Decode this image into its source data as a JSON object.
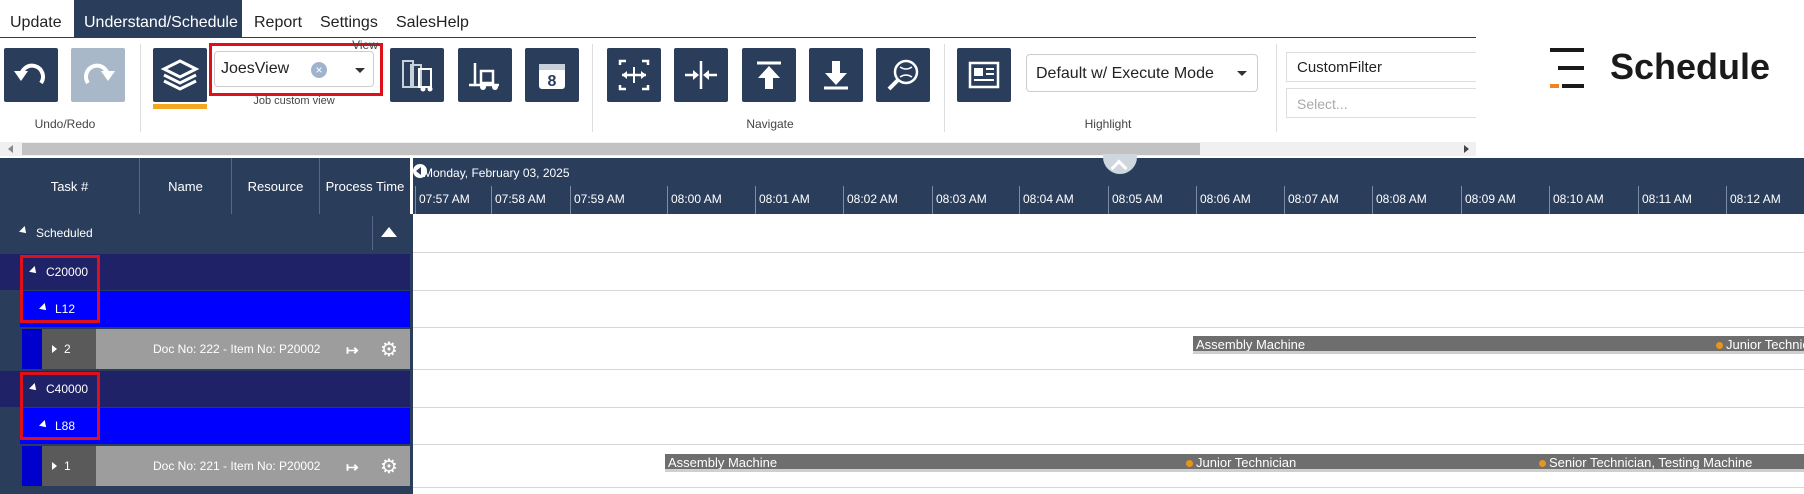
{
  "menu": {
    "items": [
      {
        "label": "Update"
      },
      {
        "label": "Understand/Schedule"
      },
      {
        "label": "Report"
      },
      {
        "label": "Settings"
      },
      {
        "label": "SalesHelp"
      }
    ]
  },
  "ribbon": {
    "groups": {
      "undo_redo": "Undo/Redo",
      "view": "View",
      "navigate": "Navigate",
      "highlight": "Highlight"
    },
    "view_select": {
      "value": "JoesView",
      "caption": "Job custom view"
    },
    "highlight_select": {
      "value": "Default w/ Execute Mode"
    },
    "custom_filter": {
      "label": "CustomFilter",
      "placeholder": "Select..."
    }
  },
  "brand": {
    "name": "Schedule",
    "accent": "#f58220"
  },
  "grid": {
    "columns": [
      "Task #",
      "Name",
      "Resource",
      "Process Time"
    ],
    "group_label": "Scheduled",
    "rows": [
      {
        "kind": "customer",
        "label": "C20000"
      },
      {
        "kind": "line",
        "label": "L12"
      },
      {
        "kind": "task",
        "task": "2",
        "doc": "Doc No: 222 - Item No: P20002"
      },
      {
        "kind": "customer",
        "label": "C40000"
      },
      {
        "kind": "line",
        "label": "L88"
      },
      {
        "kind": "task",
        "task": "1",
        "doc": "Doc No: 221 - Item No: P20002"
      }
    ]
  },
  "timeline": {
    "date_label": "Monday, February 03, 2025",
    "ticks": [
      "07:57 AM",
      "07:58 AM",
      "07:59 AM",
      "08:00 AM",
      "08:01 AM",
      "08:02 AM",
      "08:03 AM",
      "08:04 AM",
      "08:05 AM",
      "08:06 AM",
      "08:07 AM",
      "08:08 AM",
      "08:09 AM",
      "08:10 AM",
      "08:11 AM",
      "08:12 AM"
    ],
    "bars_row1": [
      {
        "label": "Assembly Machine"
      },
      {
        "label": "Junior Technician"
      }
    ],
    "bars_row2": [
      {
        "label": "Assembly Machine"
      },
      {
        "label": "Junior Technician"
      },
      {
        "label": "Senior Technician, Testing Machine"
      }
    ]
  },
  "colors": {
    "navy": "#2a3e5c",
    "customer_row": "#1f2266",
    "line_row": "#0000ff",
    "highlight": "#e0101a",
    "task_bar": "#6e6e6e"
  }
}
